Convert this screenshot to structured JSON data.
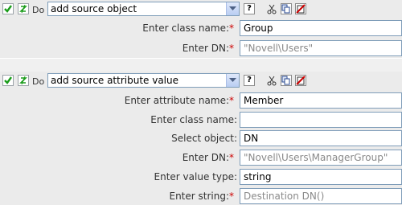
{
  "action1": {
    "do_label": "Do",
    "action": "add source object",
    "fields": [
      {
        "label": "Enter class name:",
        "required": "*",
        "value": "Group",
        "placeholder": ""
      },
      {
        "label": "Enter DN:",
        "required": "*",
        "value": "",
        "placeholder": "\"Novell\\Users\""
      }
    ]
  },
  "action2": {
    "do_label": "Do",
    "action": "add source attribute value",
    "fields": [
      {
        "label": "Enter attribute name:",
        "required": "*",
        "value": "Member",
        "placeholder": ""
      },
      {
        "label": "Enter class name:",
        "required": "",
        "value": "",
        "placeholder": ""
      },
      {
        "label": "Select object:",
        "required": "",
        "value": "DN",
        "placeholder": ""
      },
      {
        "label": "Enter DN:",
        "required": "*",
        "value": "",
        "placeholder": "\"Novell\\Users\\ManagerGroup\""
      },
      {
        "label": "Enter value type:",
        "required": "",
        "value": "string",
        "placeholder": ""
      },
      {
        "label": "Enter string:",
        "required": "*",
        "value": "",
        "placeholder": "Destination DN()"
      }
    ]
  },
  "toolbar": {
    "help": "?"
  },
  "colors": {
    "accent": "#7f9db9",
    "required": "#cc0000",
    "check": "#1a9c1a",
    "delete": "#cc0000"
  }
}
